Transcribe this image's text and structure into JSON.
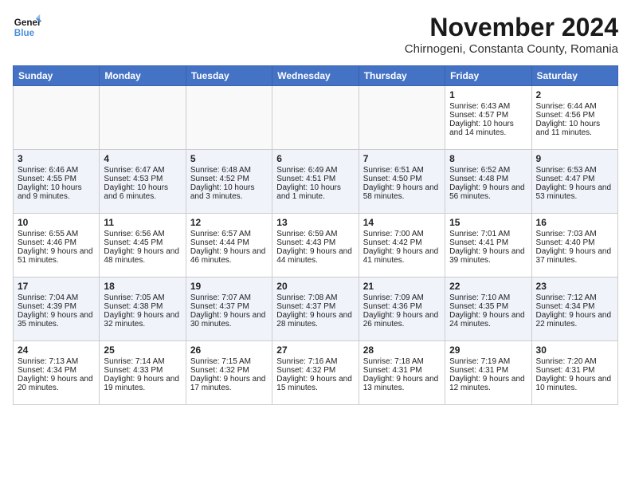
{
  "header": {
    "logo_general": "General",
    "logo_blue": "Blue",
    "month_year": "November 2024",
    "location": "Chirnogeni, Constanta County, Romania"
  },
  "weekdays": [
    "Sunday",
    "Monday",
    "Tuesday",
    "Wednesday",
    "Thursday",
    "Friday",
    "Saturday"
  ],
  "weeks": [
    [
      {
        "day": "",
        "sunrise": "",
        "sunset": "",
        "daylight": ""
      },
      {
        "day": "",
        "sunrise": "",
        "sunset": "",
        "daylight": ""
      },
      {
        "day": "",
        "sunrise": "",
        "sunset": "",
        "daylight": ""
      },
      {
        "day": "",
        "sunrise": "",
        "sunset": "",
        "daylight": ""
      },
      {
        "day": "",
        "sunrise": "",
        "sunset": "",
        "daylight": ""
      },
      {
        "day": "1",
        "sunrise": "Sunrise: 6:43 AM",
        "sunset": "Sunset: 4:57 PM",
        "daylight": "Daylight: 10 hours and 14 minutes."
      },
      {
        "day": "2",
        "sunrise": "Sunrise: 6:44 AM",
        "sunset": "Sunset: 4:56 PM",
        "daylight": "Daylight: 10 hours and 11 minutes."
      }
    ],
    [
      {
        "day": "3",
        "sunrise": "Sunrise: 6:46 AM",
        "sunset": "Sunset: 4:55 PM",
        "daylight": "Daylight: 10 hours and 9 minutes."
      },
      {
        "day": "4",
        "sunrise": "Sunrise: 6:47 AM",
        "sunset": "Sunset: 4:53 PM",
        "daylight": "Daylight: 10 hours and 6 minutes."
      },
      {
        "day": "5",
        "sunrise": "Sunrise: 6:48 AM",
        "sunset": "Sunset: 4:52 PM",
        "daylight": "Daylight: 10 hours and 3 minutes."
      },
      {
        "day": "6",
        "sunrise": "Sunrise: 6:49 AM",
        "sunset": "Sunset: 4:51 PM",
        "daylight": "Daylight: 10 hours and 1 minute."
      },
      {
        "day": "7",
        "sunrise": "Sunrise: 6:51 AM",
        "sunset": "Sunset: 4:50 PM",
        "daylight": "Daylight: 9 hours and 58 minutes."
      },
      {
        "day": "8",
        "sunrise": "Sunrise: 6:52 AM",
        "sunset": "Sunset: 4:48 PM",
        "daylight": "Daylight: 9 hours and 56 minutes."
      },
      {
        "day": "9",
        "sunrise": "Sunrise: 6:53 AM",
        "sunset": "Sunset: 4:47 PM",
        "daylight": "Daylight: 9 hours and 53 minutes."
      }
    ],
    [
      {
        "day": "10",
        "sunrise": "Sunrise: 6:55 AM",
        "sunset": "Sunset: 4:46 PM",
        "daylight": "Daylight: 9 hours and 51 minutes."
      },
      {
        "day": "11",
        "sunrise": "Sunrise: 6:56 AM",
        "sunset": "Sunset: 4:45 PM",
        "daylight": "Daylight: 9 hours and 48 minutes."
      },
      {
        "day": "12",
        "sunrise": "Sunrise: 6:57 AM",
        "sunset": "Sunset: 4:44 PM",
        "daylight": "Daylight: 9 hours and 46 minutes."
      },
      {
        "day": "13",
        "sunrise": "Sunrise: 6:59 AM",
        "sunset": "Sunset: 4:43 PM",
        "daylight": "Daylight: 9 hours and 44 minutes."
      },
      {
        "day": "14",
        "sunrise": "Sunrise: 7:00 AM",
        "sunset": "Sunset: 4:42 PM",
        "daylight": "Daylight: 9 hours and 41 minutes."
      },
      {
        "day": "15",
        "sunrise": "Sunrise: 7:01 AM",
        "sunset": "Sunset: 4:41 PM",
        "daylight": "Daylight: 9 hours and 39 minutes."
      },
      {
        "day": "16",
        "sunrise": "Sunrise: 7:03 AM",
        "sunset": "Sunset: 4:40 PM",
        "daylight": "Daylight: 9 hours and 37 minutes."
      }
    ],
    [
      {
        "day": "17",
        "sunrise": "Sunrise: 7:04 AM",
        "sunset": "Sunset: 4:39 PM",
        "daylight": "Daylight: 9 hours and 35 minutes."
      },
      {
        "day": "18",
        "sunrise": "Sunrise: 7:05 AM",
        "sunset": "Sunset: 4:38 PM",
        "daylight": "Daylight: 9 hours and 32 minutes."
      },
      {
        "day": "19",
        "sunrise": "Sunrise: 7:07 AM",
        "sunset": "Sunset: 4:37 PM",
        "daylight": "Daylight: 9 hours and 30 minutes."
      },
      {
        "day": "20",
        "sunrise": "Sunrise: 7:08 AM",
        "sunset": "Sunset: 4:37 PM",
        "daylight": "Daylight: 9 hours and 28 minutes."
      },
      {
        "day": "21",
        "sunrise": "Sunrise: 7:09 AM",
        "sunset": "Sunset: 4:36 PM",
        "daylight": "Daylight: 9 hours and 26 minutes."
      },
      {
        "day": "22",
        "sunrise": "Sunrise: 7:10 AM",
        "sunset": "Sunset: 4:35 PM",
        "daylight": "Daylight: 9 hours and 24 minutes."
      },
      {
        "day": "23",
        "sunrise": "Sunrise: 7:12 AM",
        "sunset": "Sunset: 4:34 PM",
        "daylight": "Daylight: 9 hours and 22 minutes."
      }
    ],
    [
      {
        "day": "24",
        "sunrise": "Sunrise: 7:13 AM",
        "sunset": "Sunset: 4:34 PM",
        "daylight": "Daylight: 9 hours and 20 minutes."
      },
      {
        "day": "25",
        "sunrise": "Sunrise: 7:14 AM",
        "sunset": "Sunset: 4:33 PM",
        "daylight": "Daylight: 9 hours and 19 minutes."
      },
      {
        "day": "26",
        "sunrise": "Sunrise: 7:15 AM",
        "sunset": "Sunset: 4:32 PM",
        "daylight": "Daylight: 9 hours and 17 minutes."
      },
      {
        "day": "27",
        "sunrise": "Sunrise: 7:16 AM",
        "sunset": "Sunset: 4:32 PM",
        "daylight": "Daylight: 9 hours and 15 minutes."
      },
      {
        "day": "28",
        "sunrise": "Sunrise: 7:18 AM",
        "sunset": "Sunset: 4:31 PM",
        "daylight": "Daylight: 9 hours and 13 minutes."
      },
      {
        "day": "29",
        "sunrise": "Sunrise: 7:19 AM",
        "sunset": "Sunset: 4:31 PM",
        "daylight": "Daylight: 9 hours and 12 minutes."
      },
      {
        "day": "30",
        "sunrise": "Sunrise: 7:20 AM",
        "sunset": "Sunset: 4:31 PM",
        "daylight": "Daylight: 9 hours and 10 minutes."
      }
    ]
  ]
}
